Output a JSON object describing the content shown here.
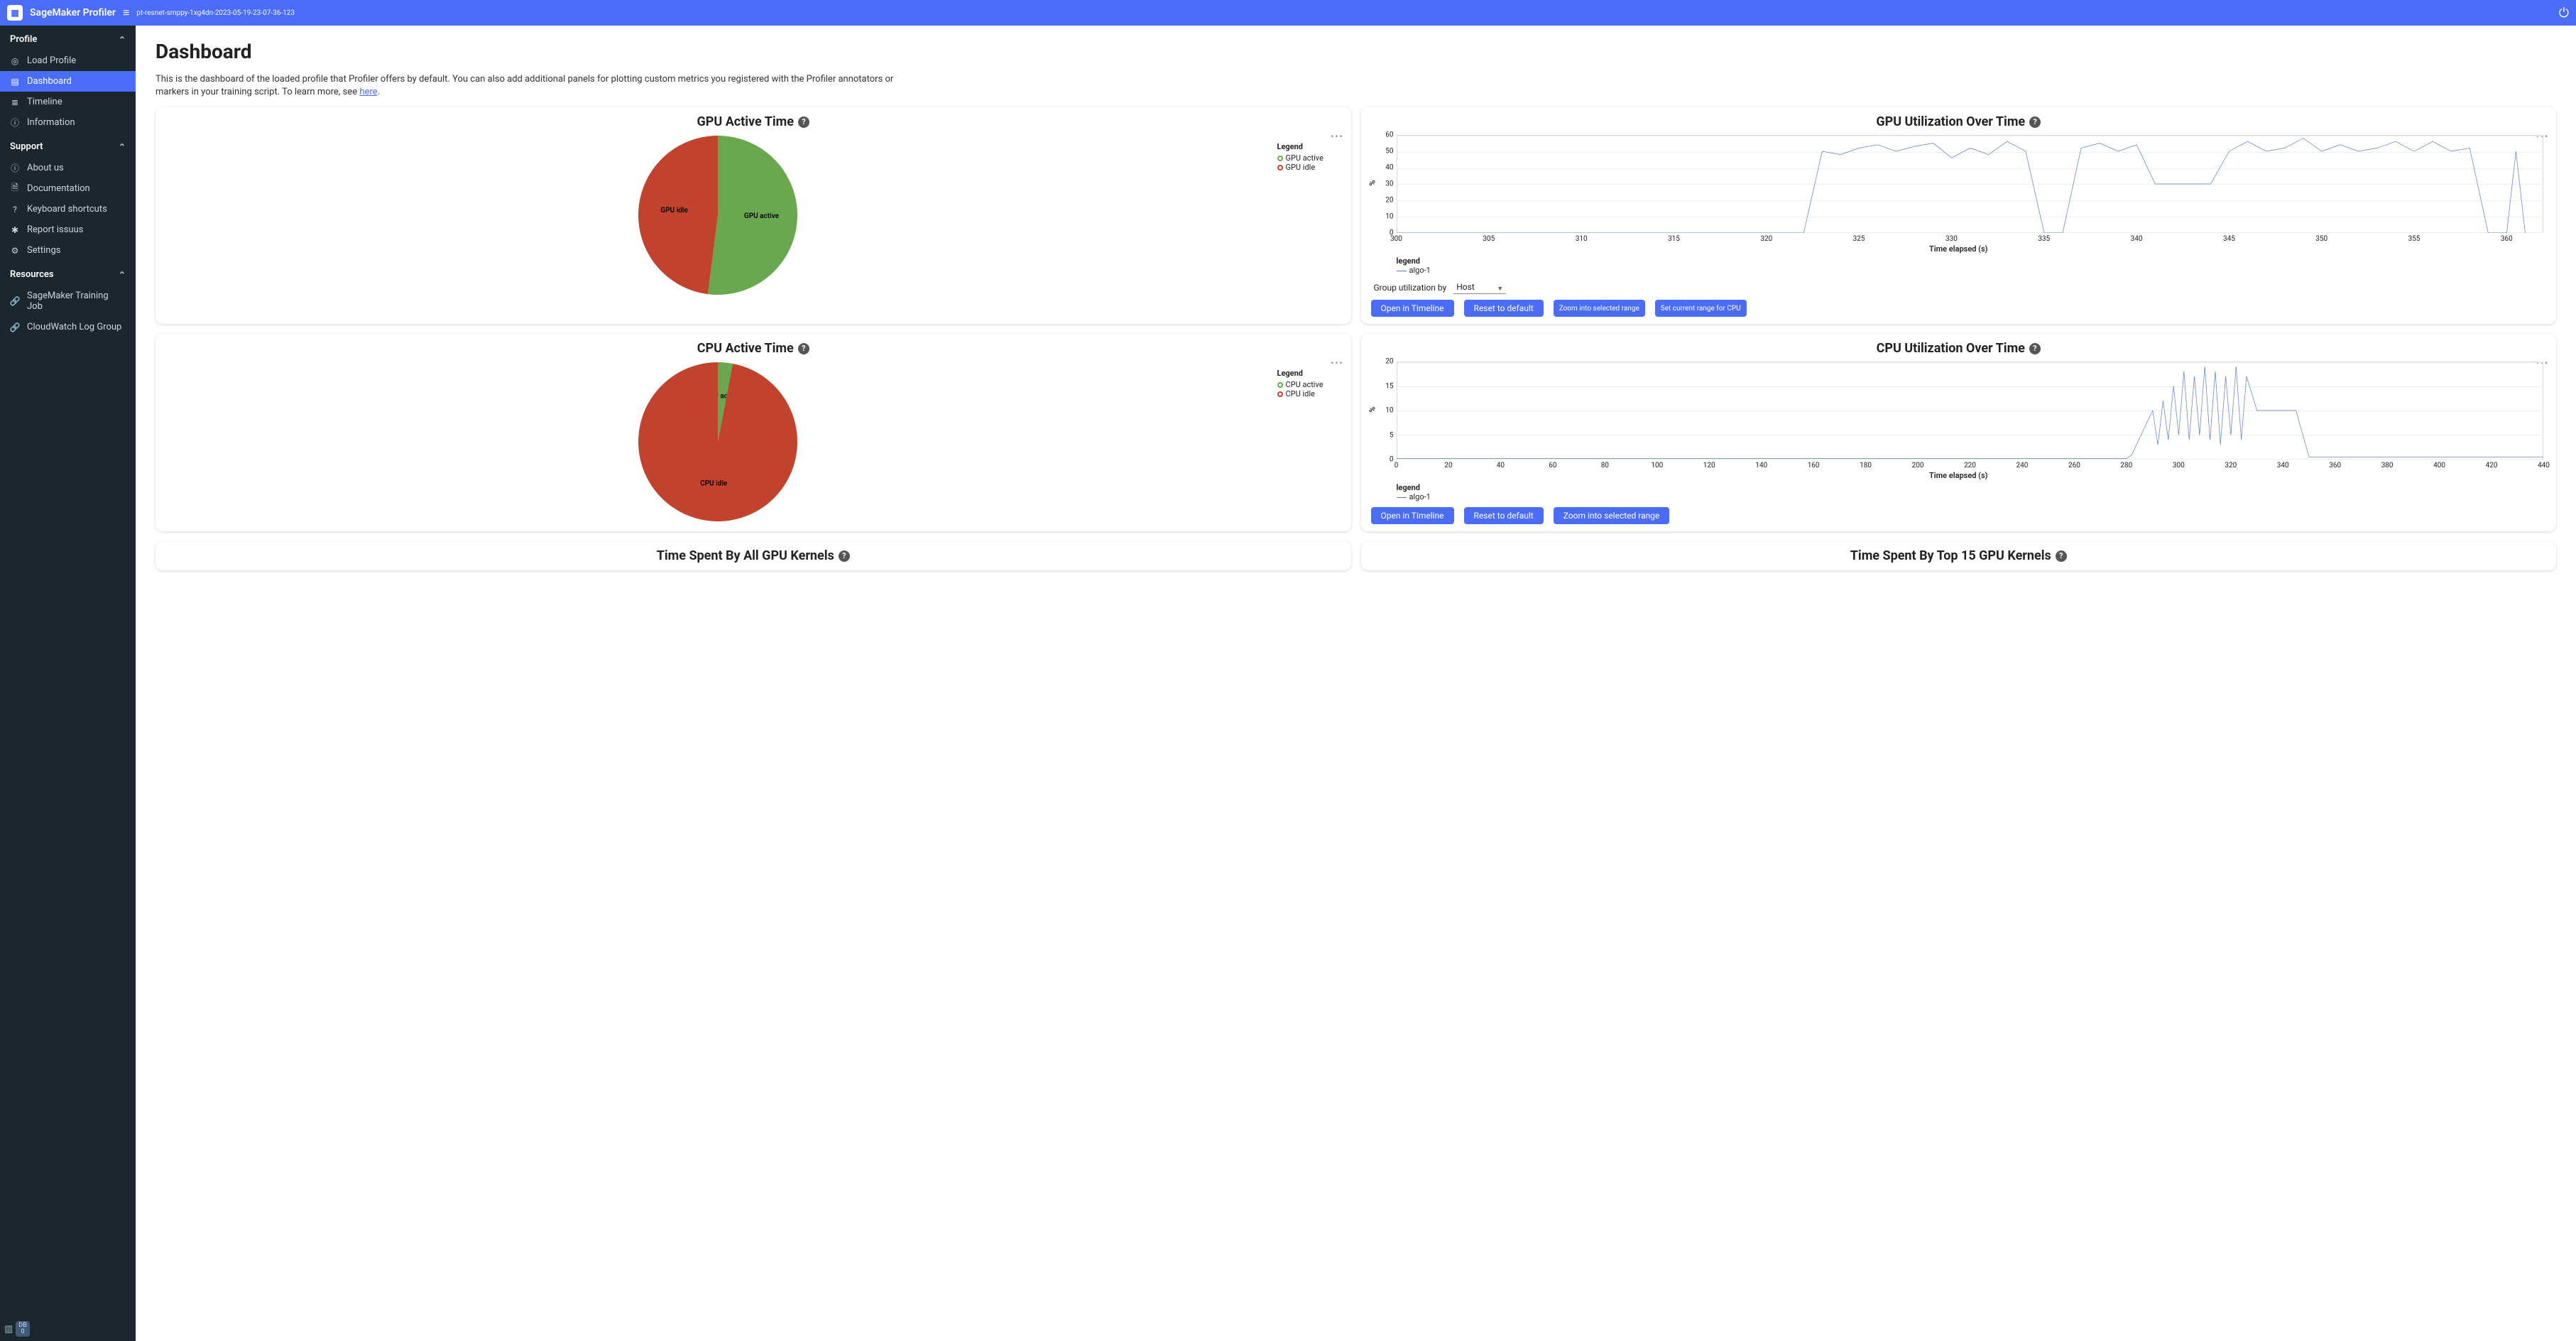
{
  "header": {
    "appName": "SageMaker Profiler",
    "jobName": "pt-resnet-smppy-1xg4dn-2023-05-19-23-07-36-123"
  },
  "sidebar": {
    "sections": [
      {
        "title": "Profile",
        "items": [
          {
            "icon": "compass",
            "label": "Load Profile"
          },
          {
            "icon": "dashboard",
            "label": "Dashboard",
            "active": true
          },
          {
            "icon": "timeline",
            "label": "Timeline"
          },
          {
            "icon": "info",
            "label": "Information"
          }
        ]
      },
      {
        "title": "Support",
        "items": [
          {
            "icon": "info",
            "label": "About us"
          },
          {
            "icon": "doc",
            "label": "Documentation"
          },
          {
            "icon": "help",
            "label": "Keyboard shortcuts"
          },
          {
            "icon": "bug",
            "label": "Report issuus"
          },
          {
            "icon": "gear",
            "label": "Settings"
          }
        ]
      },
      {
        "title": "Resources",
        "items": [
          {
            "icon": "link",
            "label": "SageMaker Training Job"
          },
          {
            "icon": "link",
            "label": "CloudWatch Log Group"
          }
        ]
      }
    ],
    "bottomBadge": {
      "line1": "DB",
      "line2": "0"
    }
  },
  "main": {
    "title": "Dashboard",
    "introPrefix": "This is the dashboard of the loaded profile that Profiler offers by default. You can also add additional panels for plotting custom metrics you registered with the Profiler annotators or markers in your training script. To learn more, see ",
    "introLink": "here",
    "introSuffix": "."
  },
  "panels": {
    "gpuActive": {
      "title": "GPU Active Time",
      "legendTitle": "Legend",
      "items": [
        {
          "label": "GPU active",
          "color": "#6aa84f"
        },
        {
          "label": "GPU idle",
          "color": "#c1432e"
        }
      ],
      "sliceLabels": {
        "active": "GPU active",
        "idle": "GPU idle"
      }
    },
    "cpuActive": {
      "title": "CPU Active Time",
      "legendTitle": "Legend",
      "items": [
        {
          "label": "CPU active",
          "color": "#6aa84f"
        },
        {
          "label": "CPU idle",
          "color": "#c1432e"
        }
      ],
      "sliceLabels": {
        "active": "CPU active",
        "idle": "CPU idle"
      }
    },
    "gpuUtil": {
      "title": "GPU Utilization Over Time",
      "ylabel": "%",
      "xlabel": "Time elapsed (s)",
      "legendTitle": "legend",
      "series": "algo-1",
      "groupLabel": "Group utilization by",
      "groupValue": "Host",
      "buttons": [
        "Open in Timeline",
        "Reset to default",
        "Zoom into selected range",
        "Set current range for CPU"
      ]
    },
    "cpuUtil": {
      "title": "CPU Utilization Over Time",
      "ylabel": "%",
      "xlabel": "Time elapsed (s)",
      "legendTitle": "legend",
      "series": "algo-1",
      "buttons": [
        "Open in Timeline",
        "Reset to default",
        "Zoom into selected range"
      ]
    },
    "gpuKernels": {
      "title": "Time Spent By All GPU Kernels"
    },
    "top15Kernels": {
      "title": "Time Spent By Top 15 GPU Kernels"
    }
  },
  "chart_data": [
    {
      "type": "pie",
      "title": "GPU Active Time",
      "series": [
        {
          "name": "GPU active",
          "value": 52,
          "color": "#6aa84f"
        },
        {
          "name": "GPU idle",
          "value": 48,
          "color": "#c1432e"
        }
      ]
    },
    {
      "type": "pie",
      "title": "CPU Active Time",
      "series": [
        {
          "name": "CPU active",
          "value": 3,
          "color": "#6aa84f"
        },
        {
          "name": "CPU idle",
          "value": 97,
          "color": "#c1432e"
        }
      ]
    },
    {
      "type": "line",
      "title": "GPU Utilization Over Time",
      "xlabel": "Time elapsed (s)",
      "ylabel": "%",
      "xlim": [
        300,
        362
      ],
      "ylim": [
        0,
        60
      ],
      "xticks": [
        300,
        305,
        310,
        315,
        320,
        325,
        330,
        335,
        340,
        345,
        350,
        355,
        360
      ],
      "yticks": [
        0,
        10,
        20,
        30,
        40,
        50,
        60
      ],
      "series": [
        {
          "name": "algo-1",
          "color": "#5b7bc7",
          "points": [
            [
              300,
              0
            ],
            [
              322,
              0
            ],
            [
              323,
              50
            ],
            [
              324,
              48
            ],
            [
              325,
              52
            ],
            [
              326,
              54
            ],
            [
              327,
              50
            ],
            [
              328,
              53
            ],
            [
              329,
              55
            ],
            [
              330,
              46
            ],
            [
              331,
              52
            ],
            [
              332,
              48
            ],
            [
              333,
              56
            ],
            [
              334,
              50
            ],
            [
              335,
              0
            ],
            [
              336,
              0
            ],
            [
              337,
              52
            ],
            [
              338,
              55
            ],
            [
              339,
              50
            ],
            [
              340,
              54
            ],
            [
              341,
              30
            ],
            [
              342,
              30
            ],
            [
              343,
              30
            ],
            [
              344,
              30
            ],
            [
              345,
              50
            ],
            [
              346,
              56
            ],
            [
              347,
              50
            ],
            [
              348,
              52
            ],
            [
              349,
              58
            ],
            [
              350,
              50
            ],
            [
              351,
              54
            ],
            [
              352,
              50
            ],
            [
              353,
              52
            ],
            [
              354,
              56
            ],
            [
              355,
              50
            ],
            [
              356,
              56
            ],
            [
              357,
              50
            ],
            [
              358,
              52
            ],
            [
              359,
              0
            ],
            [
              360,
              0
            ],
            [
              360.5,
              50
            ],
            [
              361,
              0
            ]
          ]
        }
      ]
    },
    {
      "type": "line",
      "title": "CPU Utilization Over Time",
      "xlabel": "Time elapsed (s)",
      "ylabel": "%",
      "xlim": [
        0,
        440
      ],
      "ylim": [
        0,
        20
      ],
      "xticks": [
        0,
        20,
        40,
        60,
        80,
        100,
        120,
        140,
        160,
        180,
        200,
        220,
        240,
        260,
        280,
        300,
        320,
        340,
        360,
        380,
        400,
        420,
        440
      ],
      "yticks": [
        0,
        5,
        10,
        15,
        20
      ],
      "series": [
        {
          "name": "algo-1",
          "color": "#5b7bc7",
          "points": [
            [
              0,
              0.2
            ],
            [
              280,
              0.2
            ],
            [
              282,
              1
            ],
            [
              290,
              10
            ],
            [
              292,
              3
            ],
            [
              294,
              12
            ],
            [
              296,
              4
            ],
            [
              298,
              15
            ],
            [
              300,
              5
            ],
            [
              302,
              18
            ],
            [
              304,
              4
            ],
            [
              306,
              17
            ],
            [
              308,
              5
            ],
            [
              310,
              19
            ],
            [
              312,
              4
            ],
            [
              314,
              18
            ],
            [
              316,
              3
            ],
            [
              318,
              17
            ],
            [
              320,
              5
            ],
            [
              322,
              19
            ],
            [
              324,
              4
            ],
            [
              326,
              17
            ],
            [
              330,
              10
            ],
            [
              340,
              10
            ],
            [
              345,
              10
            ],
            [
              350,
              0.5
            ],
            [
              440,
              0.5
            ]
          ]
        }
      ]
    }
  ]
}
